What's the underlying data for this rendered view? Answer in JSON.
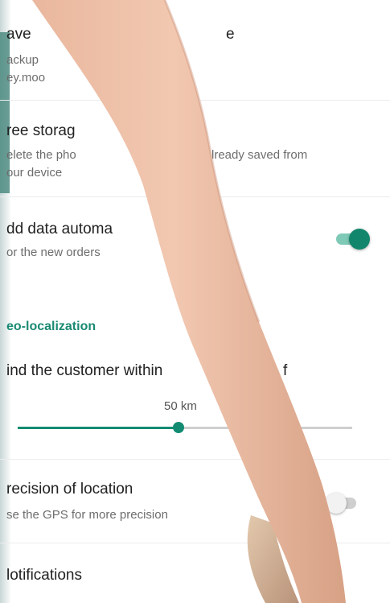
{
  "settings": {
    "save": {
      "title": "ave",
      "sub_line1": "ackup",
      "sub_line2": "ey.moo",
      "title_right": "e"
    },
    "free_storage": {
      "title": "ree storag",
      "sub_line1_left": "elete the pho",
      "sub_line1_right": "lready saved from",
      "sub_line2": "our device"
    },
    "add_data": {
      "title": "dd data automa",
      "sub": "or the new orders",
      "toggle_on": true
    },
    "geo_header": "eo-localization",
    "find_customer": {
      "title": "ind the customer within",
      "title_right": "f",
      "slider_value": "50 km",
      "slider_fraction": 0.48
    },
    "precision": {
      "title": "recision of location",
      "sub": "se the GPS for more precision",
      "toggle_on": false
    },
    "notifications": {
      "title": "lotifications"
    }
  },
  "colors": {
    "accent": "#12866c",
    "section": "#1b8a73",
    "divider": "#ececec"
  }
}
